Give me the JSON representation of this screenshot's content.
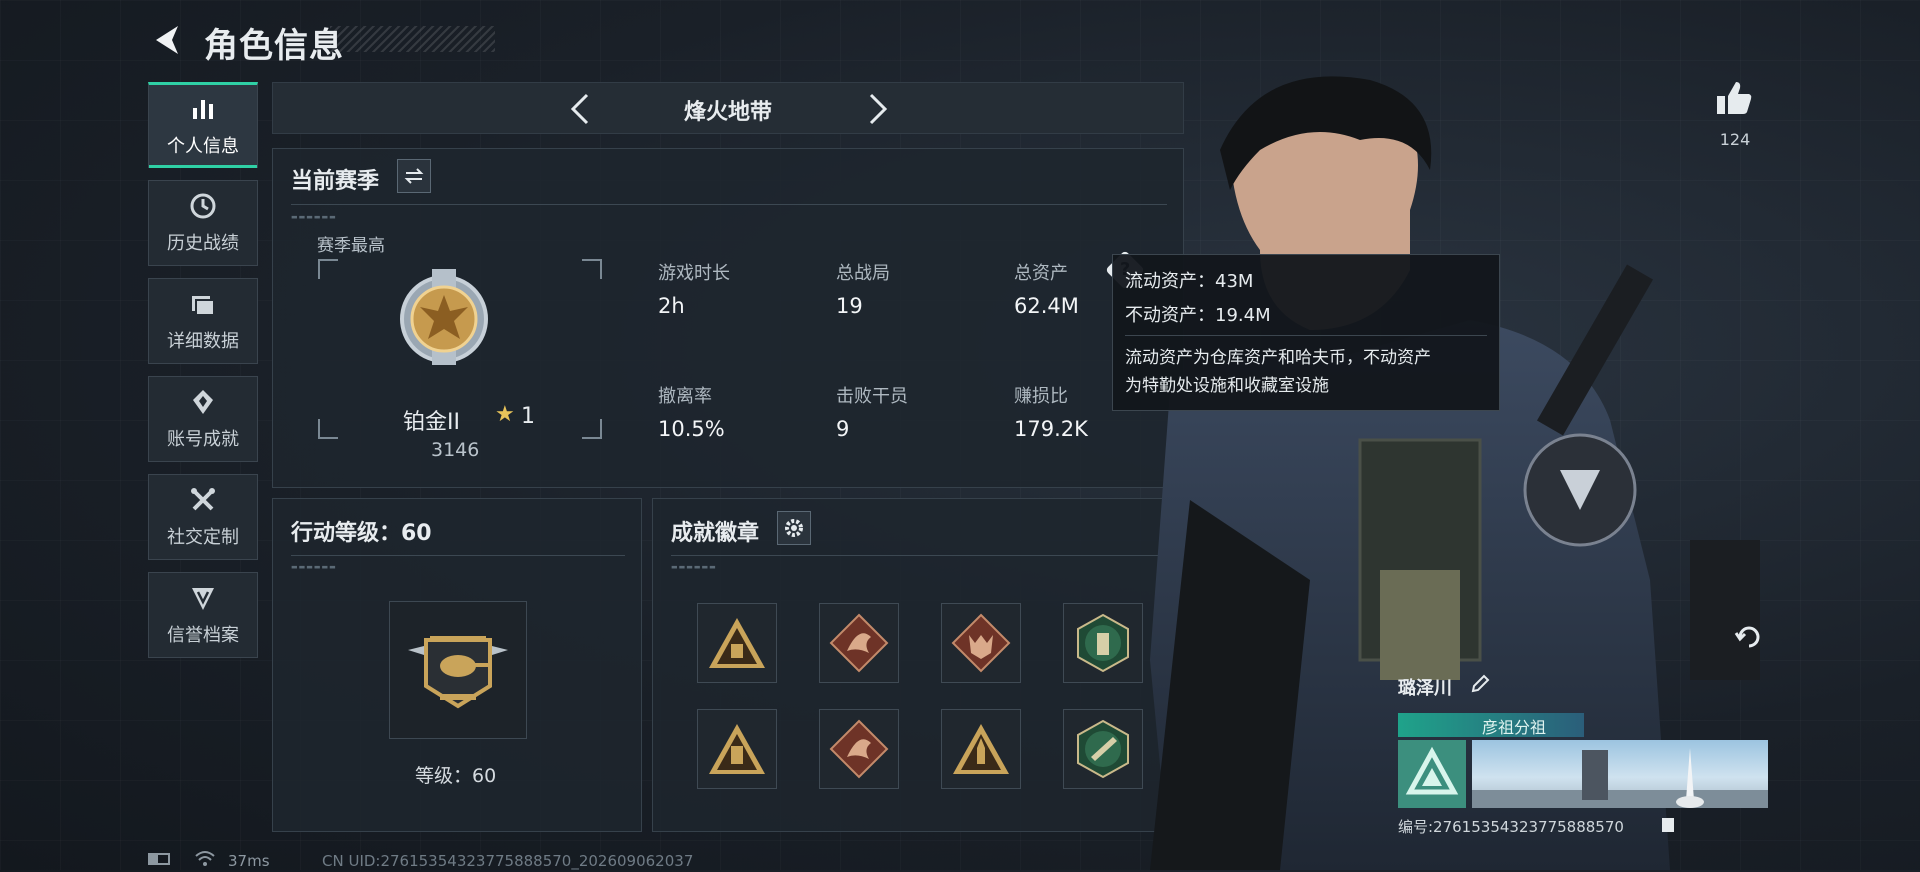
{
  "header": {
    "title": "角色信息"
  },
  "sidebar": {
    "items": [
      {
        "label": "个人信息",
        "icon": "bar-chart-icon",
        "active": true
      },
      {
        "label": "历史战绩",
        "icon": "clock-icon"
      },
      {
        "label": "详细数据",
        "icon": "folder-icon"
      },
      {
        "label": "账号成就",
        "icon": "achievement-icon"
      },
      {
        "label": "社交定制",
        "icon": "wrench-icon"
      },
      {
        "label": "信誉档案",
        "icon": "reputation-icon"
      }
    ]
  },
  "mode": {
    "label": "烽火地带"
  },
  "season": {
    "title": "当前赛季",
    "best_label": "赛季最高",
    "rank_name": "铂金II",
    "rank_stars": "1",
    "rank_score": "3146",
    "stats": [
      {
        "label": "游戏时长",
        "value": "2h"
      },
      {
        "label": "总战局",
        "value": "19"
      },
      {
        "label": "总资产",
        "value": "62.4M"
      },
      {
        "label": "撤离率",
        "value": "10.5%"
      },
      {
        "label": "击败干员",
        "value": "9"
      },
      {
        "label": "赚损比",
        "value": "179.2K"
      }
    ]
  },
  "tooltip": {
    "liquid": "流动资产：43M",
    "fixed": "不动资产：19.4M",
    "note_line1": "流动资产为仓库资产和哈夫币，不动资产",
    "note_line2": "为特勤处设施和收藏室设施"
  },
  "action_level": {
    "title": "行动等级：60",
    "level_text": "等级：60"
  },
  "achievements": {
    "title": "成就徽章",
    "badges": [
      "triangle-crate-badge",
      "dragon-badge",
      "wolf-badge",
      "hex-soldier-badge",
      "triangle-ammo-badge",
      "dragon-badge",
      "triangle-rocket-badge",
      "hex-weapon-badge"
    ]
  },
  "social": {
    "likes": "124"
  },
  "player": {
    "name": "璐泽川",
    "team": "彦祖分祖",
    "id_text": "编号:276153543237758885​70"
  },
  "status_bar": {
    "latency": "37ms",
    "uid_text": "CN UID:27615354323775888570_202609062037"
  },
  "colors": {
    "accent": "#2fd0a5",
    "panel": "#1e252d",
    "gold": "#c9a45a"
  }
}
